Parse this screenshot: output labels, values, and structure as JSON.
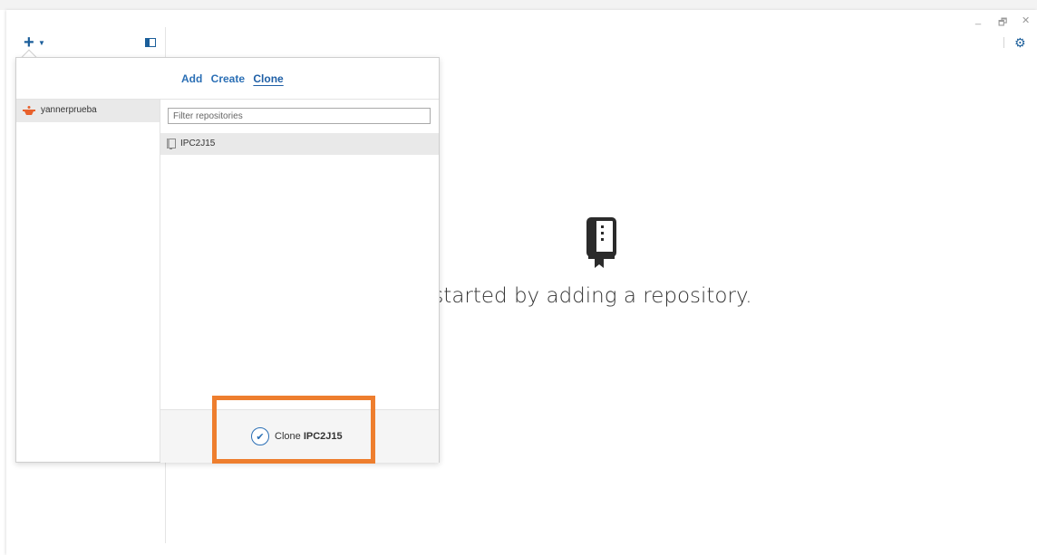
{
  "window": {
    "controls": [
      "_",
      "🗗",
      "✕"
    ]
  },
  "toolbar": {
    "add_icon": "plus-icon",
    "caret_icon": "caret-down-icon",
    "sidebar_toggle_icon": "sidebar-toggle-icon",
    "settings_icon": "gear-icon"
  },
  "popover": {
    "tabs": [
      {
        "label": "Add",
        "active": false
      },
      {
        "label": "Create",
        "active": false
      },
      {
        "label": "Clone",
        "active": true
      }
    ],
    "accounts": [
      {
        "name": "yannerprueba",
        "icon": "github-avatar-icon"
      }
    ],
    "filter": {
      "placeholder": "Filter repositories",
      "value": ""
    },
    "repositories": [
      {
        "name": "IPC2J15",
        "icon": "repo-icon",
        "selected": true
      }
    ],
    "clone_button": {
      "prefix": "Clone",
      "repo": "IPC2J15"
    }
  },
  "empty_state": {
    "icon": "book-icon",
    "message": "t started by adding a repository."
  },
  "colors": {
    "accent": "#2b6fb5",
    "highlight": "#ee7e2e",
    "selected_bg": "#e9e9e9"
  }
}
